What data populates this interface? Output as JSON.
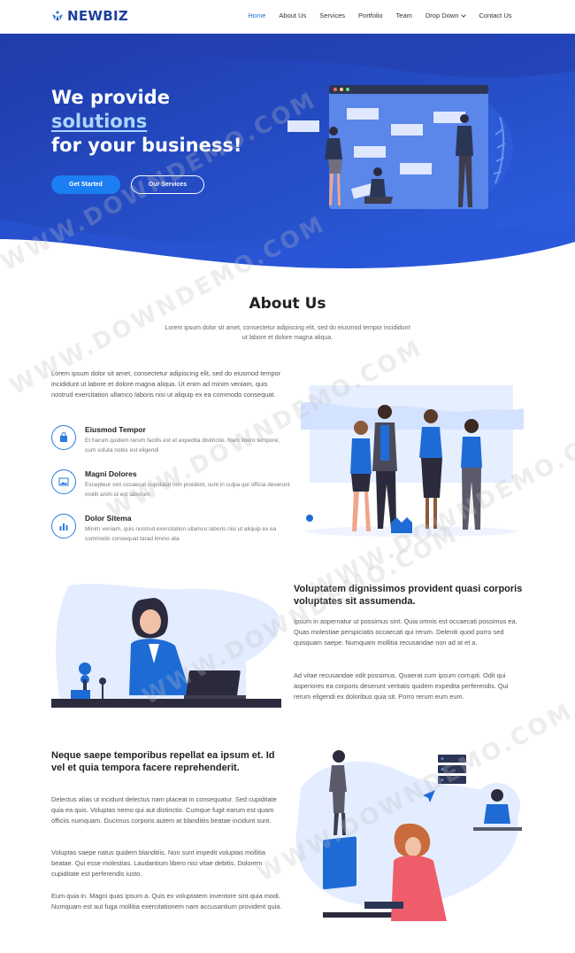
{
  "brand": {
    "name": "NEWBIZ",
    "color": "#1e3f9c"
  },
  "nav": {
    "items": [
      {
        "label": "Home",
        "active": true
      },
      {
        "label": "About Us"
      },
      {
        "label": "Services"
      },
      {
        "label": "Portfolio"
      },
      {
        "label": "Team"
      },
      {
        "label": "Drop Down",
        "has_dropdown": true
      },
      {
        "label": "Contact Us"
      }
    ],
    "accent": "#1f6bd6"
  },
  "hero": {
    "title_line1": "We provide",
    "title_highlight": "solutions",
    "title_line3": "for your business!",
    "btn_primary": "Get Started",
    "btn_secondary": "Our Services",
    "bg_colors": [
      "#1e3aa8",
      "#2a5de0"
    ]
  },
  "about": {
    "title": "About Us",
    "subtitle": "Lorem ipsum dolor sit amet, consectetur adipiscing elit, sed do eiusmod tempor incididunt ut labore et dolore magna aliqua.",
    "intro": "Lorem ipsum dolor sit amet, consectetur adipiscing elit, sed do eiusmod tempor incididunt ut labore et dolore magna aliqua. Ut enim ad minim veniam, quis nostrud exercitation ullamco laboris nisi ut aliquip ex ea commodo consequat.",
    "features": [
      {
        "icon": "shopping-bag-icon",
        "title": "Eiusmod Tempor",
        "desc": "Et harum quidem rerum facilis est et expedita distinctio. Nam libero tempore, cum soluta nobis est eligendi"
      },
      {
        "icon": "image-icon",
        "title": "Magni Dolores",
        "desc": "Excepteur sint occaecat cupidatat non proident, sunt in culpa qui officia deserunt mollit anim id est laborum"
      },
      {
        "icon": "bar-chart-icon",
        "title": "Dolor Sitema",
        "desc": "Minim veniam, quis nostrud exercitation ullamco laboris nisi ut aliquip ex ea commodo consequat tarad limino ata"
      }
    ]
  },
  "section2": {
    "title": "Voluptatem dignissimos provident quasi corporis voluptates sit assumenda.",
    "p1": "Ipsum in aspernatur ut possimus sint. Quia omnis est occaecati possimus ea. Quas molestiae perspiciatis occaecati qui rerum. Deleniti quod porro sed quisquam saepe. Numquam mollitia recusandae non ad at et a.",
    "p2": "Ad vitae recusandae odit possimus. Quaerat cum ipsum corrupti. Odit qui asperiores ea corporis deserunt veritatis quidem expedita perferendis. Qui rerum eligendi ex doloribus quia sit. Porro rerum eum eum."
  },
  "section3": {
    "title": "Neque saepe temporibus repellat ea ipsum et. Id vel et quia tempora facere reprehenderit.",
    "p1": "Delectus alias ut incidunt delectus nam placeat in consequatur. Sed cupiditate quia ea quis. Voluptas nemo qui aut distinctio. Cumque fugit earum est quam officiis numquam. Ducimus corporis autem at blanditiis beatae incidunt sunt.",
    "p2": "Voluptas saepe natus quidem blanditiis. Non sunt impedit voluptas mollitia beatae. Qui esse molestias. Laudantium libero nisi vitae debitis. Dolorem cupiditate est perferendis iusto.",
    "p3": "Eum quia in. Magni quas ipsum a. Quis ex voluptatem inventore sint quia modi. Numquam est aut fuga mollitia exercitationem nam accusantium provident quia."
  },
  "watermark": "WWW.DOWNDEMO.COM"
}
